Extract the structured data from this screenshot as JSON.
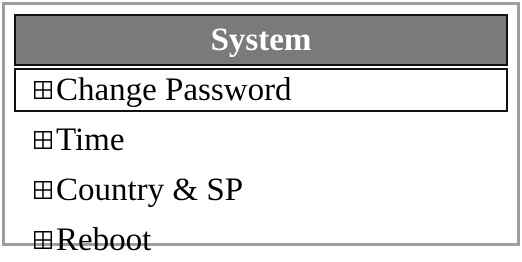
{
  "panel": {
    "title": "System"
  },
  "menu": {
    "items": [
      {
        "label": "Change Password",
        "icon": "expand-box-icon",
        "selected": true
      },
      {
        "label": "Time",
        "icon": "expand-box-icon",
        "selected": false
      },
      {
        "label": "Country & SP",
        "icon": "expand-box-icon",
        "selected": false
      },
      {
        "label": "Reboot",
        "icon": "expand-box-icon",
        "selected": false
      }
    ]
  }
}
